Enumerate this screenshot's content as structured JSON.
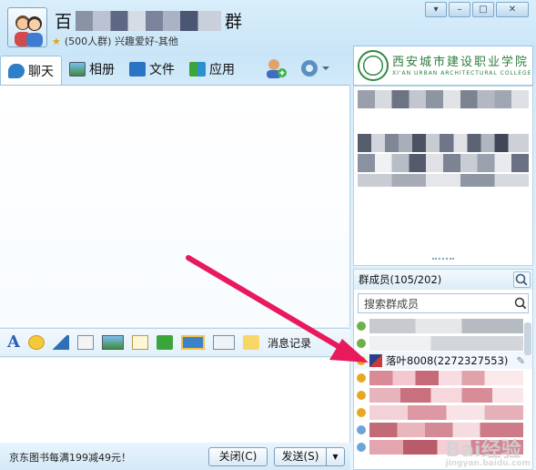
{
  "header": {
    "title_prefix": "百",
    "title_suffix": "群",
    "subtitle": "(500人群) 兴趣爱好-其他"
  },
  "window_buttons": [
    "▾",
    "–",
    "□",
    "✕"
  ],
  "tabs": [
    {
      "label": "聊天",
      "icon": "chat-bubble-icon"
    },
    {
      "label": "相册",
      "icon": "photo-album-icon"
    },
    {
      "label": "文件",
      "icon": "folder-icon"
    },
    {
      "label": "应用",
      "icon": "apps-grid-icon"
    }
  ],
  "logo": {
    "line1": "西安城市建设职业学院",
    "line2": "XI'AN URBAN ARCHITECTURAL COLLEGE"
  },
  "editbar": {
    "history_label": "消息记录"
  },
  "bottom": {
    "ad_text": "京东图书每满199减49元！",
    "close_label": "关闭(C)",
    "send_label": "发送(S)"
  },
  "members": {
    "header": "群成员(105/202)",
    "search_placeholder": "搜索群成员",
    "selected_member": "落叶8008(2272327553)"
  },
  "watermark": {
    "text": "Bai经验",
    "sub": "jingyan.baidu.com"
  },
  "colors": {
    "accent": "#e8195c",
    "header_blue": "#c9e5f7",
    "logo_green": "#2a7c3c"
  }
}
